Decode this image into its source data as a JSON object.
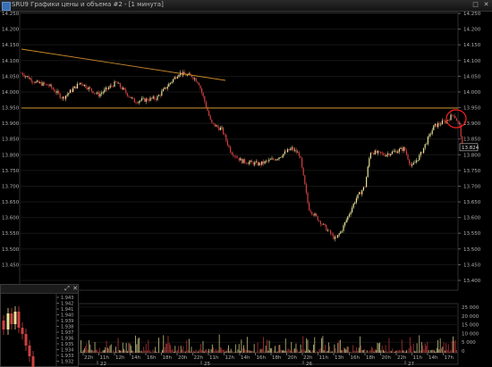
{
  "window": {
    "title": "SRU9 Графики цены и объема #2 - [1 минута]",
    "buttons": {
      "maximize": "□",
      "close": "✕"
    }
  },
  "mini_window": {
    "buttons": {
      "expand": "⤢",
      "close": "✕"
    },
    "price_ticks": [
      "1.943",
      "1.942",
      "1.941",
      "1.940",
      "1.939",
      "1.938",
      "1.937",
      "1.936",
      "1.935",
      "1.934",
      "1.933",
      "1.932"
    ]
  },
  "price_axis": {
    "ticks_left": [
      "14.250",
      "14.200",
      "14.150",
      "14.100",
      "14.050",
      "14.000",
      "13.950",
      "13.900",
      "13.850",
      "13.800",
      "13.750",
      "13.700",
      "13.650",
      "13.600",
      "13.550",
      "13.500",
      "13.450"
    ],
    "ticks_right": [
      "14.250",
      "14.200",
      "14.150",
      "14.100",
      "14.050",
      "14.000",
      "13.950",
      "13.900",
      "13.850",
      "13.800",
      "13.750",
      "13.700",
      "13.650",
      "13.600",
      "13.550",
      "13.500",
      "13.450",
      "13.400"
    ],
    "current_price": "13.824"
  },
  "volume_axis": {
    "ticks": [
      "25 000",
      "20 000",
      "15 000",
      "10 000",
      "5 000",
      "0"
    ]
  },
  "time_axis": {
    "hours": [
      "22h",
      "11h",
      "12h",
      "14h",
      "16h",
      "18h",
      "20h",
      "22h",
      "11h",
      "12h",
      "14h",
      "16h",
      "18h",
      "20h",
      "22h",
      "11h",
      "13h",
      "16h",
      "18h",
      "20h",
      "22h",
      "11h",
      "14h",
      "17h"
    ],
    "days": [
      "22",
      "25",
      "26",
      "27"
    ]
  },
  "colors": {
    "background": "#000000",
    "grid": "#3a3a3a",
    "candle_up": "#e8e49a",
    "candle_down": "#d04040",
    "trend_line": "#c88a2a",
    "support_line": "#c88a2a",
    "highlight_circle": "#ff2020"
  }
}
